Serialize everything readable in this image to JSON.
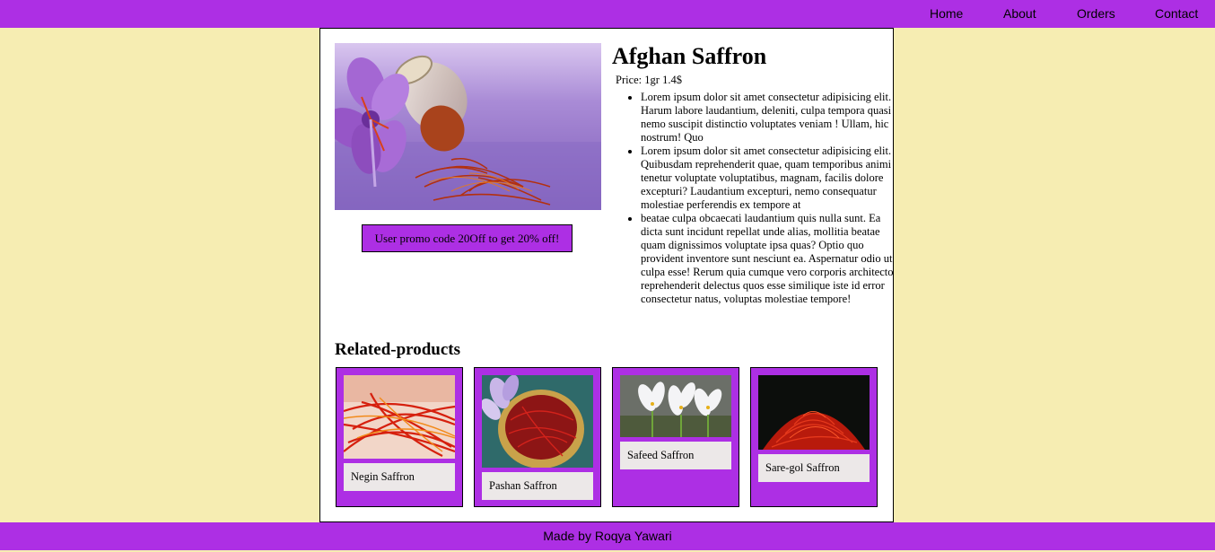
{
  "nav": {
    "items": [
      {
        "label": "Home"
      },
      {
        "label": "About"
      },
      {
        "label": "Orders"
      },
      {
        "label": "Contact"
      }
    ]
  },
  "product": {
    "title": "Afghan Saffron",
    "price": "Price: 1gr 1.4$",
    "promo": "User promo code 20Off to get 20% off!",
    "description": [
      "Lorem ipsum dolor sit amet consectetur adipisicing elit. Harum labore laudantium, deleniti, culpa tempora quasi nemo suscipit distinctio voluptates veniam ! Ullam, hic nostrum! Quo",
      "Lorem ipsum dolor sit amet consectetur adipisicing elit. Quibusdam reprehenderit quae, quam temporibus animi tenetur voluptate voluptatibus, magnam, facilis dolore excepturi? Laudantium excepturi, nemo consequatur molestiae perferendis ex tempore at",
      "beatae culpa obcaecati laudantium quis nulla sunt. Ea dicta sunt incidunt repellat unde alias, mollitia beatae quam dignissimos voluptate ipsa quas? Optio quo provident inventore sunt nesciunt ea. Aspernatur odio ut culpa esse! Rerum quia cumque vero corporis architecto reprehenderit delectus quos esse similique iste id error consectetur natus, voluptas molestiae tempore!"
    ]
  },
  "related": {
    "heading": "Related-products",
    "items": [
      {
        "label": "Negin Saffron"
      },
      {
        "label": "Pashan Saffron"
      },
      {
        "label": "Safeed Saffron"
      },
      {
        "label": "Sare-gol Saffron"
      }
    ]
  },
  "footer": {
    "text": "Made by Roqya Yawari"
  },
  "colors": {
    "nav_bg": "#ad2fe4",
    "page_bg": "#f6edb2",
    "card_bg": "#ad2fe4",
    "label_bg": "#ece8e8"
  }
}
